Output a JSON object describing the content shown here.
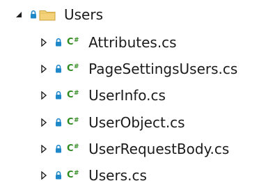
{
  "tree": {
    "folder": {
      "label": "Users",
      "expanded": true,
      "icon": "folder-icon",
      "lock_icon": "lock-icon",
      "expander_icon": "expanded-triangle-icon"
    },
    "files": [
      {
        "label": "Attributes.cs",
        "expanded": false,
        "icon": "csharp-icon"
      },
      {
        "label": "PageSettingsUsers.cs",
        "expanded": false,
        "icon": "csharp-icon"
      },
      {
        "label": "UserInfo.cs",
        "expanded": false,
        "icon": "csharp-icon"
      },
      {
        "label": "UserObject.cs",
        "expanded": false,
        "icon": "csharp-icon"
      },
      {
        "label": "UserRequestBody.cs",
        "expanded": false,
        "icon": "csharp-icon"
      },
      {
        "label": "Users.cs",
        "expanded": false,
        "icon": "csharp-icon"
      }
    ],
    "cs_badge": "C",
    "cs_badge_sup": "#"
  },
  "colors": {
    "text": "#1b1b1b",
    "lock": "#1f88c9",
    "csharp": "#2f8a1f",
    "folder_fill": "#f4d27a",
    "folder_stroke": "#c9a23e",
    "expander": "#1e1e1e"
  }
}
